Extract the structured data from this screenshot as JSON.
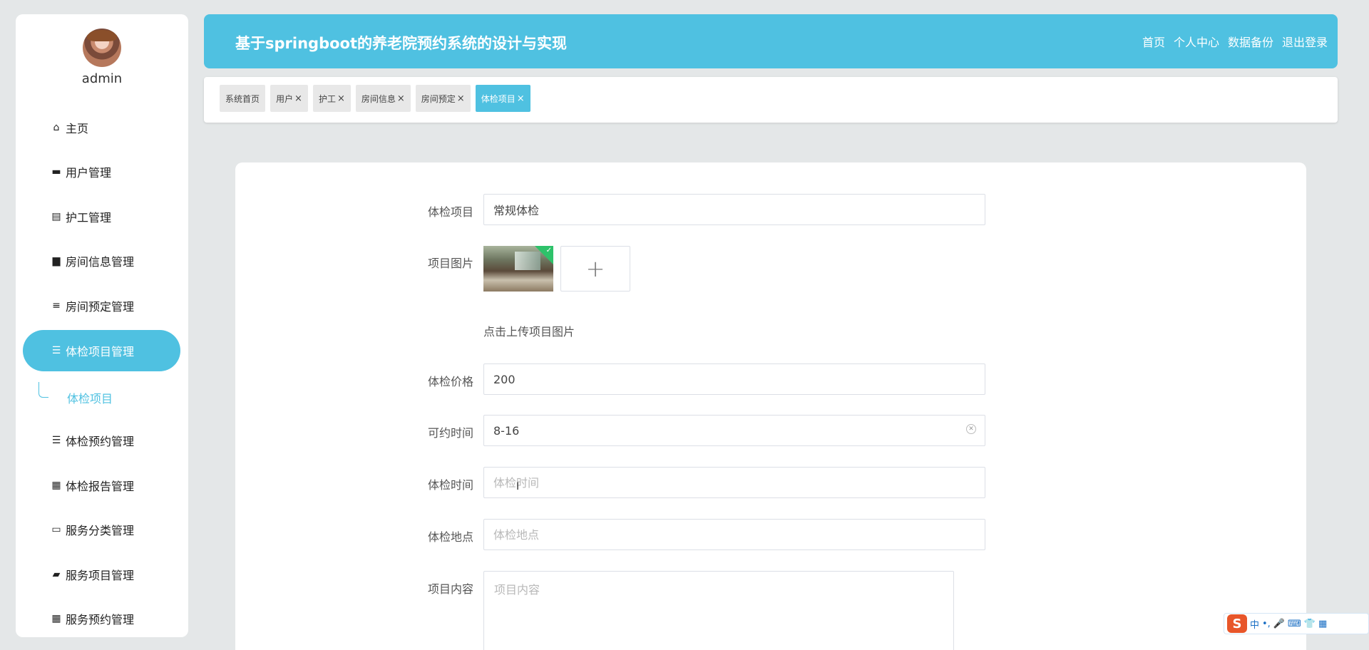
{
  "sidebar": {
    "username": "admin",
    "items": [
      {
        "label": "主页",
        "icon": "home-icon",
        "glyph": "⌂"
      },
      {
        "label": "用户管理",
        "icon": "briefcase-icon",
        "glyph": "▬"
      },
      {
        "label": "护工管理",
        "icon": "clipboard-icon",
        "glyph": "▤"
      },
      {
        "label": "房间信息管理",
        "icon": "inbox-icon",
        "glyph": "▆"
      },
      {
        "label": "房间预定管理",
        "icon": "sliders-icon",
        "glyph": "≡"
      },
      {
        "label": "体检项目管理",
        "icon": "list-icon",
        "glyph": "☰"
      },
      {
        "label": "体检预约管理",
        "icon": "list-icon",
        "glyph": "☰"
      },
      {
        "label": "体检报告管理",
        "icon": "grid-icon",
        "glyph": "▦"
      },
      {
        "label": "服务分类管理",
        "icon": "monitor-icon",
        "glyph": "▭"
      },
      {
        "label": "服务项目管理",
        "icon": "wallet-icon",
        "glyph": "▰"
      },
      {
        "label": "服务预约管理",
        "icon": "grid-icon",
        "glyph": "▦"
      }
    ],
    "submenu_label": "体检项目"
  },
  "header": {
    "title": "基于springboot的养老院预约系统的设计与实现",
    "nav": [
      "首页",
      "个人中心",
      "数据备份",
      "退出登录"
    ]
  },
  "tabs": [
    {
      "label": "系统首页",
      "closable": false
    },
    {
      "label": "用户",
      "closable": true
    },
    {
      "label": "护工",
      "closable": true
    },
    {
      "label": "房间信息",
      "closable": true
    },
    {
      "label": "房间预定",
      "closable": true
    },
    {
      "label": "体检项目",
      "closable": true,
      "active": true
    }
  ],
  "form": {
    "item_name": {
      "label": "体检项目",
      "value": "常规体检"
    },
    "image": {
      "label": "项目图片",
      "hint": "点击上传项目图片",
      "plus": "+"
    },
    "price": {
      "label": "体检价格",
      "value": "200"
    },
    "available_time": {
      "label": "可约时间",
      "value": "8-16"
    },
    "exam_time": {
      "label": "体检时间",
      "placeholder": "体检时间"
    },
    "location": {
      "label": "体检地点",
      "placeholder": "体检地点"
    },
    "content": {
      "label": "项目内容",
      "placeholder": "项目内容"
    }
  },
  "ime": {
    "logo": "S",
    "items": [
      "中",
      "•,",
      "🎤",
      "⌨",
      "👕",
      "▦"
    ]
  },
  "colors": {
    "accent": "#4fc1e1",
    "background": "#e4e7e8"
  }
}
